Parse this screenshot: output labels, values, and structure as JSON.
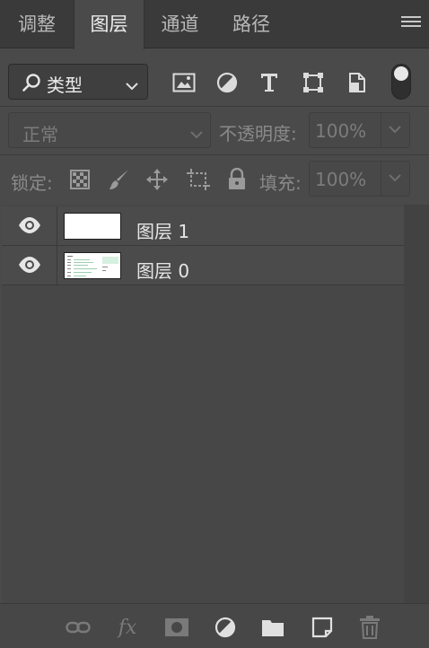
{
  "tabs": [
    {
      "label": "调整"
    },
    {
      "label": "图层",
      "active": true
    },
    {
      "label": "通道"
    },
    {
      "label": "路径"
    }
  ],
  "filter": {
    "kind_label": "类型",
    "icons": [
      "image-filter-icon",
      "adjustment-filter-icon",
      "type-filter-icon",
      "shape-filter-icon",
      "smart-object-filter-icon"
    ],
    "toggle_on": true
  },
  "blend": {
    "mode": "正常",
    "opacity_label": "不透明度:",
    "opacity_value": "100%"
  },
  "lock": {
    "label": "锁定:",
    "fill_label": "填充:",
    "fill_value": "100%"
  },
  "layers": [
    {
      "name": "图层 1",
      "visible": true,
      "thumb": "blank"
    },
    {
      "name": "图层 0",
      "visible": true,
      "thumb": "document"
    }
  ],
  "colors": {
    "panel_bg": "#4a4a4a",
    "tab_bg": "#3a3a3a",
    "text": "#e6e6e6",
    "muted": "#8a8a8a"
  }
}
